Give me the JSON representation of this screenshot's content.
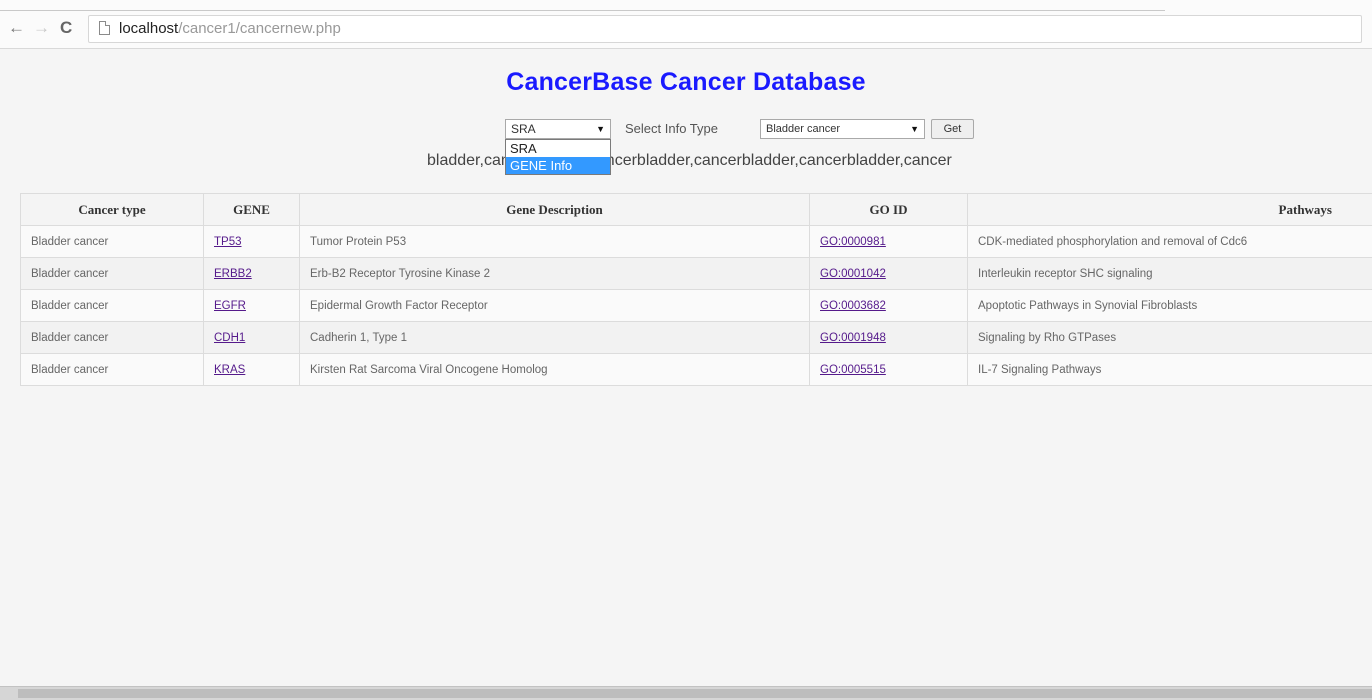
{
  "browser": {
    "back_icon": "←",
    "forward_icon": "→",
    "reload_icon": "C",
    "url_host": "localhost",
    "url_path": "/cancer1/cancernew.php"
  },
  "page": {
    "title": "CancerBase Cancer Database"
  },
  "controls": {
    "info_select_value": "SRA",
    "select_info_type_label": "Select Info Type",
    "type_select_value": "Bladder cancer",
    "get_button": "Get",
    "dropdown_options": [
      "SRA",
      "GENE Info"
    ],
    "result_text": "bladder,cancerbladder,cancerbladder,cancerbladder,cancerbladder,cancer"
  },
  "table": {
    "headers": [
      "Cancer type",
      "GENE",
      "Gene Description",
      "GO ID",
      "Pathways"
    ],
    "rows": [
      [
        "Bladder cancer",
        "TP53",
        "Tumor Protein P53",
        "GO:0000981",
        "CDK-mediated phosphorylation and removal of Cdc6"
      ],
      [
        "Bladder cancer",
        "ERBB2",
        "Erb-B2 Receptor Tyrosine Kinase 2",
        "GO:0001042",
        "Interleukin receptor SHC signaling"
      ],
      [
        "Bladder cancer",
        "EGFR",
        "Epidermal Growth Factor Receptor",
        "GO:0003682",
        "Apoptotic Pathways in Synovial Fibroblasts"
      ],
      [
        "Bladder cancer",
        "CDH1",
        "Cadherin 1, Type 1",
        "GO:0001948",
        "Signaling by Rho GTPases"
      ],
      [
        "Bladder cancer",
        "KRAS",
        "Kirsten Rat Sarcoma Viral Oncogene Homolog",
        "GO:0005515",
        "IL-7 Signaling Pathways"
      ]
    ]
  }
}
